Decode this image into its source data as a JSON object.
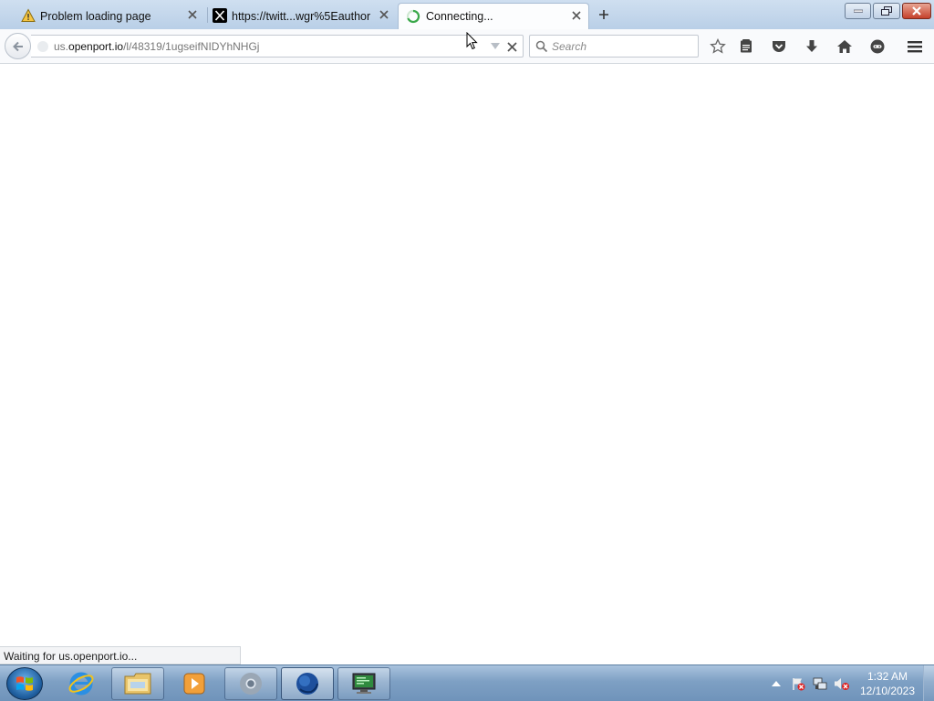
{
  "browser": {
    "tabs": [
      {
        "title": "Problem loading page",
        "icon": "warning-icon",
        "state": "inactive"
      },
      {
        "title": "https://twitt...wgr%5Eauthor",
        "icon": "x-logo-icon",
        "state": "inactive"
      },
      {
        "title": "Connecting...",
        "icon": "loading-spinner-icon",
        "state": "active"
      }
    ],
    "url": {
      "prefix": "us.",
      "host": "openport.io",
      "path": "/l/48319/1ugseifNIDYhNHGj"
    },
    "search": {
      "placeholder": "Search"
    },
    "toolbar_icons": [
      "bookmark-star-icon",
      "reading-list-icon",
      "pocket-icon",
      "download-icon",
      "home-icon",
      "chat-icon",
      "menu-icon"
    ],
    "status_text": "Waiting for us.openport.io..."
  },
  "taskbar": {
    "apps": [
      {
        "name": "internet-explorer",
        "icon": "ie-icon"
      },
      {
        "name": "file-explorer",
        "icon": "folder-icon"
      },
      {
        "name": "media-player",
        "icon": "media-player-icon"
      },
      {
        "name": "chrome",
        "icon": "chrome-icon"
      },
      {
        "name": "firefox",
        "icon": "firefox-icon"
      },
      {
        "name": "terminal",
        "icon": "monitor-icon"
      }
    ],
    "clock": {
      "time": "1:32 AM",
      "date": "12/10/2023"
    }
  },
  "colors": {
    "tabstrip": "#c4d7ec",
    "taskbar": "#7ea0c4",
    "accent_green": "#3aa84a"
  }
}
